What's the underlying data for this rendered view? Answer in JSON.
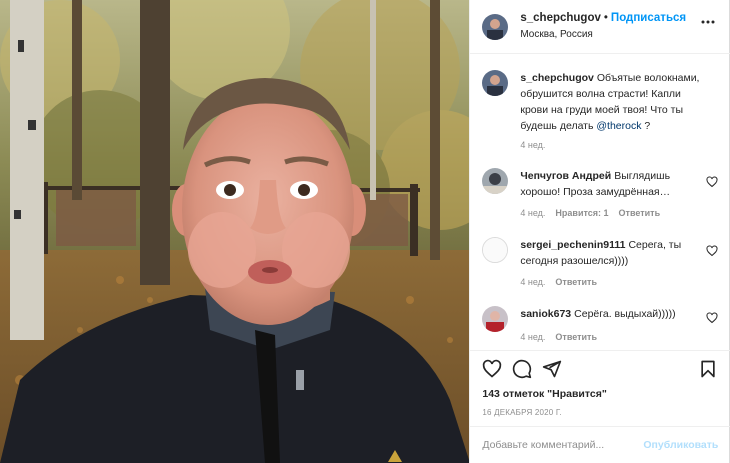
{
  "post": {
    "username": "s_chepchugov",
    "follow_label": "Подписаться",
    "location": "Москва, Россия",
    "caption_user": "s_chepchugov",
    "caption_text": "Объятые волокнами, обрушится волна страсти! Капли крови на груди моей твоя! Что ты будешь делать ",
    "caption_mention": "@therock",
    "caption_end": " ?",
    "caption_time": "4 нед."
  },
  "comments": [
    {
      "user": "Чепчугов Андрей",
      "text": "Выглядишь хорошо! Проза замудрённая…",
      "time": "4 нед.",
      "likes": "Нравится: 1",
      "reply": "Ответить"
    },
    {
      "user": "sergei_pechenin9111",
      "text": "Серега, ты сегодня разошелся))))",
      "time": "4 нед.",
      "reply": "Ответить"
    },
    {
      "user": "saniok673",
      "text": "Серёга. выдыхай)))))",
      "time": "4 нед.",
      "reply": "Ответить"
    }
  ],
  "actions": {
    "icons": [
      "heart-icon",
      "comment-icon",
      "share-icon",
      "bookmark-icon"
    ],
    "likes_count": "143 отметок",
    "likes_suffix": "\"Нравится\"",
    "date": "16 ДЕКАБРЯ 2020 Г.",
    "comment_placeholder": "Добавьте комментарий...",
    "publish_label": "Опубликовать"
  },
  "colors": {
    "accent": "#0095f6",
    "text": "#262626",
    "muted": "#8e8e8e",
    "border": "#efefef"
  }
}
